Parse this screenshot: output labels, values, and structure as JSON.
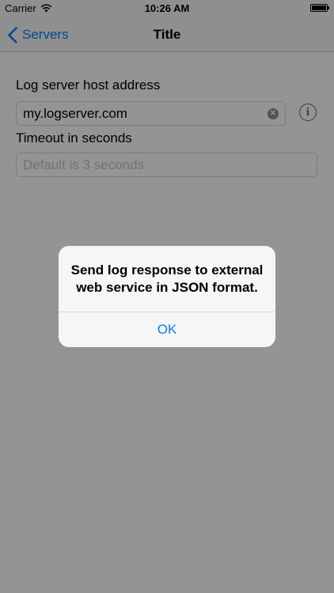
{
  "status_bar": {
    "carrier": "Carrier",
    "time": "10:26 AM"
  },
  "nav_bar": {
    "back_label": "Servers",
    "title": "Title"
  },
  "form": {
    "host_label": "Log server host address",
    "host_value": "my.logserver.com",
    "timeout_label": "Timeout in seconds",
    "timeout_placeholder": "Default is 3 seconds"
  },
  "alert": {
    "message": "Send log response to external web service in JSON format.",
    "button_label": "OK"
  },
  "colors": {
    "accent": "#0a7aff",
    "overlay": "rgba(0,0,0,0.42)"
  }
}
